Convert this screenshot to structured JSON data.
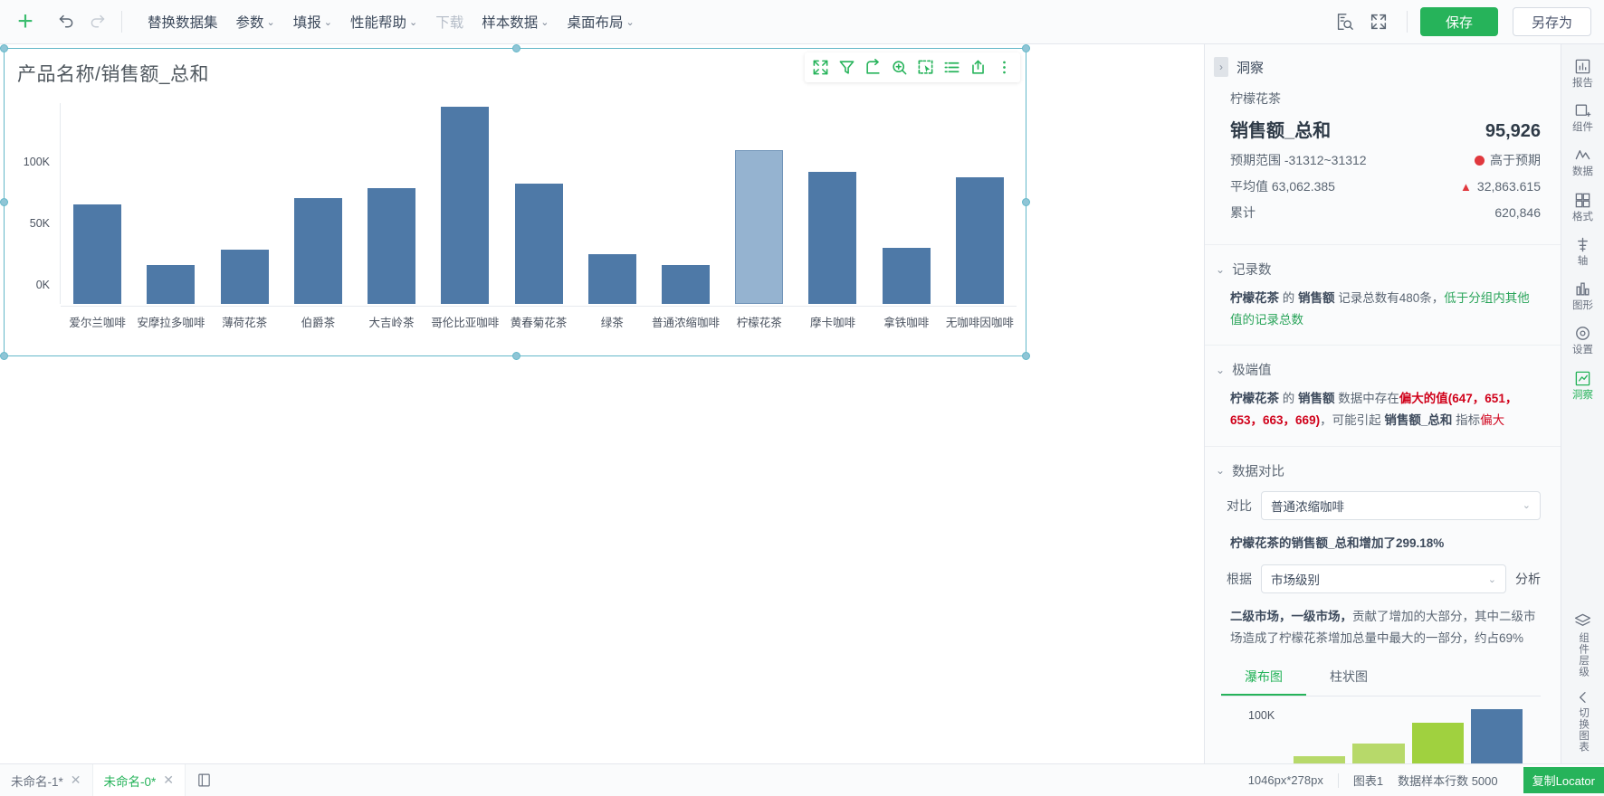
{
  "toolbar": {
    "add_label": "+",
    "undo_icon": "undo-icon",
    "redo_icon": "redo-icon",
    "menu": [
      {
        "label": "替换数据集",
        "caret": false,
        "disabled": false
      },
      {
        "label": "参数",
        "caret": true,
        "disabled": false
      },
      {
        "label": "填报",
        "caret": true,
        "disabled": false
      },
      {
        "label": "性能帮助",
        "caret": true,
        "disabled": false
      },
      {
        "label": "下载",
        "caret": false,
        "disabled": true
      },
      {
        "label": "样本数据",
        "caret": true,
        "disabled": false
      },
      {
        "label": "桌面布局",
        "caret": true,
        "disabled": false
      }
    ],
    "preview_icon": "document-search-icon",
    "fullscreen_icon": "fullscreen-icon",
    "save_label": "保存",
    "save_as_label": "另存为",
    "accent_green": "#26b35a"
  },
  "chart_tools": [
    {
      "icon": "expand-icon",
      "name": "expand"
    },
    {
      "icon": "filter-icon",
      "name": "filter"
    },
    {
      "icon": "refresh-icon",
      "name": "refresh"
    },
    {
      "icon": "zoom-in-icon",
      "name": "zoom-in"
    },
    {
      "icon": "select-area-icon",
      "name": "select-area"
    },
    {
      "icon": "list-view-icon",
      "name": "list-view"
    },
    {
      "icon": "export-icon",
      "name": "export"
    },
    {
      "icon": "more-vertical-icon",
      "name": "more"
    }
  ],
  "chart_data": {
    "type": "bar",
    "title": "产品名称/销售额_总和",
    "xlabel": "产品名称",
    "ylabel": "销售额_总和",
    "ylim": [
      0,
      125000
    ],
    "ytick_labels": [
      "100K",
      "50K",
      "0K"
    ],
    "ytick_values": [
      100000,
      50000,
      0
    ],
    "grid": false,
    "bar_color": "#4e79a7",
    "selected_bar_color": "#95b3d0",
    "selected_category": "柠檬花茶",
    "categories": [
      "爱尔兰咖啡",
      "安摩拉多咖啡",
      "薄荷花茶",
      "伯爵茶",
      "大吉岭茶",
      "哥伦比亚咖啡",
      "黄春菊花茶",
      "绿茶",
      "普通浓缩咖啡",
      "柠檬花茶",
      "摩卡咖啡",
      "拿铁咖啡",
      "无咖啡因咖啡"
    ],
    "values": [
      62000,
      24000,
      34000,
      66000,
      72000,
      123000,
      75000,
      31000,
      24000,
      95926,
      82000,
      35000,
      79000
    ]
  },
  "insight": {
    "header_title": "洞察",
    "collapse_icon": "chevron-right-icon",
    "kpi": {
      "dimension": "柠檬花茶",
      "measure_title": "销售额_总和",
      "measure_value": "95,926",
      "expected_range_label": "预期范围",
      "expected_range_value": "-31312~31312",
      "expected_status": "高于预期",
      "average_label": "平均值",
      "average_value": "63,062.385",
      "delta_value": "32,863.615",
      "total_label": "累计",
      "total_value": "620,846",
      "status_color": "#e0383e"
    },
    "sections": [
      {
        "key": "record_count",
        "title": "记录数",
        "text_parts": [
          {
            "t": "柠檬花茶",
            "s": "b"
          },
          {
            "t": " 的 ",
            "s": ""
          },
          {
            "t": "销售额",
            "s": "b"
          },
          {
            "t": " 记录总数有480条，",
            "s": ""
          },
          {
            "t": "低于分组内其他值的记录总数",
            "s": "ok"
          }
        ]
      },
      {
        "key": "extremes",
        "title": "极端值",
        "text_parts": [
          {
            "t": "柠檬花茶",
            "s": "b"
          },
          {
            "t": " 的 ",
            "s": ""
          },
          {
            "t": "销售额",
            "s": "b"
          },
          {
            "t": " 数据中存在",
            "s": ""
          },
          {
            "t": "偏大的值(647，651，653，663，669)",
            "s": "warn"
          },
          {
            "t": "，可能引起 ",
            "s": ""
          },
          {
            "t": "销售额_总和",
            "s": "b"
          },
          {
            "t": " 指标",
            "s": ""
          },
          {
            "t": "偏大",
            "s": "warnx"
          }
        ]
      }
    ],
    "comparison": {
      "title": "数据对比",
      "compare_label": "对比",
      "compare_value": "普通浓缩咖啡",
      "summary": "柠檬花茶的销售额_总和增加了299.18%",
      "basis_label": "根据",
      "basis_value": "市场级别",
      "analyze_label": "分析",
      "result_bold": "二级市场，一级市场，",
      "result_rest": "贡献了增加的大部分，其中二级市场造成了柠檬花茶增加总量中最大的一部分，约占69%",
      "tabs": [
        {
          "label": "瀑布图",
          "active": true
        },
        {
          "label": "柱状图",
          "active": false
        }
      ],
      "mini_chart": {
        "type": "bar",
        "ytick_label": "100K",
        "values": [
          18,
          32,
          55,
          70
        ],
        "colors": [
          "#b7d96a",
          "#b7d96a",
          "#a0d13f",
          "#4e79a7"
        ]
      }
    }
  },
  "rail": {
    "items": [
      {
        "label": "报告",
        "icon": "report-icon",
        "active": false
      },
      {
        "label": "组件",
        "icon": "component-icon",
        "active": false
      },
      {
        "label": "数据",
        "icon": "data-icon",
        "active": false
      },
      {
        "label": "格式",
        "icon": "format-icon",
        "active": false
      },
      {
        "label": "轴",
        "icon": "axis-icon",
        "active": false
      },
      {
        "label": "图形",
        "icon": "shape-icon",
        "active": false
      },
      {
        "label": "设置",
        "icon": "settings-icon",
        "active": false
      },
      {
        "label": "洞察",
        "icon": "insight-icon",
        "active": true
      }
    ],
    "layer_label": "组件层级",
    "layer_icon": "layers-icon",
    "switch_label": "切换图表",
    "switch_icon": "chevron-left-icon"
  },
  "statusbar": {
    "tabs": [
      {
        "label": "未命名-1*",
        "active": false
      },
      {
        "label": "未命名-0*",
        "active": true
      }
    ],
    "new_sheet_icon": "new-sheet-icon",
    "size_text": "1046px*278px",
    "chart_name": "图表1",
    "sample_rows": "数据样本行数 5000",
    "locator_label": "复制Locator"
  }
}
